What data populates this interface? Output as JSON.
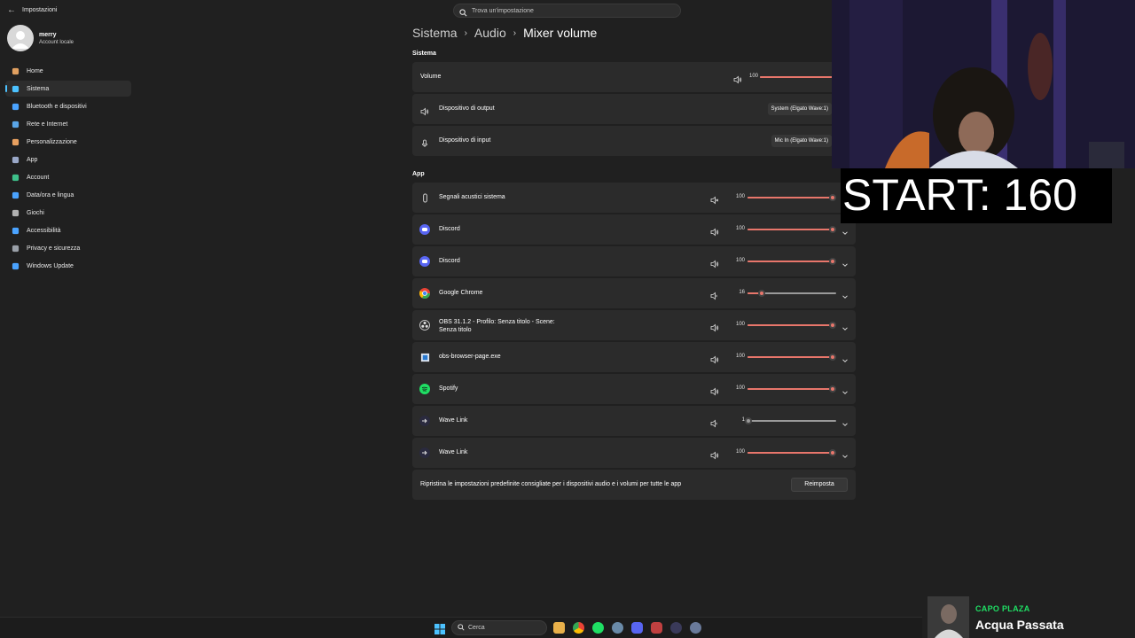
{
  "window": {
    "title": "Impostazioni"
  },
  "search": {
    "placeholder": "Trova un'impostazione"
  },
  "profile": {
    "name": "merry",
    "account_type": "Account locale"
  },
  "sidebar": {
    "items": [
      {
        "label": "Home",
        "icon": "home-icon",
        "color": "#e0a060"
      },
      {
        "label": "Sistema",
        "icon": "system-icon",
        "color": "#4cc2ff",
        "active": true
      },
      {
        "label": "Bluetooth e dispositivi",
        "icon": "bluetooth-icon",
        "color": "#4aa3ff"
      },
      {
        "label": "Rete e Internet",
        "icon": "wifi-icon",
        "color": "#5aa6e8"
      },
      {
        "label": "Personalizzazione",
        "icon": "brush-icon",
        "color": "#e8a060"
      },
      {
        "label": "App",
        "icon": "apps-icon",
        "color": "#9aa8c8"
      },
      {
        "label": "Account",
        "icon": "account-icon",
        "color": "#3ec08a"
      },
      {
        "label": "Data/ora e lingua",
        "icon": "globe-icon",
        "color": "#4aa3ff"
      },
      {
        "label": "Giochi",
        "icon": "gamepad-icon",
        "color": "#b0b0b0"
      },
      {
        "label": "Accessibilità",
        "icon": "accessibility-icon",
        "color": "#4aa3ff"
      },
      {
        "label": "Privacy e sicurezza",
        "icon": "shield-icon",
        "color": "#9aa0a8"
      },
      {
        "label": "Windows Update",
        "icon": "update-icon",
        "color": "#4aa3ff"
      }
    ]
  },
  "breadcrumb": {
    "items": [
      "Sistema",
      "Audio",
      "Mixer volume"
    ]
  },
  "system_section": {
    "title": "Sistema",
    "volume": {
      "label": "Volume",
      "value": "100",
      "level": 1.0
    },
    "output": {
      "label": "Dispositivo di output",
      "selected": "System (Elgato Wave:1)"
    },
    "input": {
      "label": "Dispositivo di input",
      "selected": "Mic In (Elgato Wave:1)"
    }
  },
  "app_section": {
    "title": "App",
    "apps": [
      {
        "name": "Segnali acustici sistema",
        "icon": "system-sounds-icon",
        "value": "100",
        "level": 1.0,
        "muted": true,
        "expandable": false
      },
      {
        "name": "Discord",
        "icon": "discord-icon",
        "value": "100",
        "level": 1.0,
        "muted": false,
        "expandable": true
      },
      {
        "name": "Discord",
        "icon": "discord-icon",
        "value": "100",
        "level": 1.0,
        "muted": false,
        "expandable": true
      },
      {
        "name": "Google Chrome",
        "icon": "chrome-icon",
        "value": "16",
        "level": 0.16,
        "muted": false,
        "low": true,
        "expandable": true
      },
      {
        "name": "OBS 31.1.2 - Profilo: Senza titolo - Scene: Senza titolo",
        "icon": "obs-icon",
        "value": "100",
        "level": 1.0,
        "muted": false,
        "expandable": true
      },
      {
        "name": "obs-browser-page.exe",
        "icon": "app-window-icon",
        "value": "100",
        "level": 1.0,
        "muted": false,
        "expandable": true
      },
      {
        "name": "Spotify",
        "icon": "spotify-icon",
        "value": "100",
        "level": 1.0,
        "muted": false,
        "expandable": true
      },
      {
        "name": "Wave Link",
        "icon": "wavelink-icon",
        "value": "1",
        "level": 0.01,
        "muted": false,
        "low": true,
        "expandable": true
      },
      {
        "name": "Wave Link",
        "icon": "wavelink-icon",
        "value": "100",
        "level": 1.0,
        "muted": false,
        "expandable": true
      }
    ]
  },
  "reset": {
    "text": "Ripristina le impostazioni predefinite consigliate per i dispositivi audio e i volumi per tutte le app",
    "button": "Reimposta"
  },
  "overlay": {
    "start_text": "START: 160"
  },
  "now_playing": {
    "artist": "CAPO PLAZA",
    "title": "Acqua Passata"
  },
  "taskbar": {
    "search_placeholder": "Cerca"
  },
  "colors": {
    "accent": "#4cc2ff",
    "slider": "#e8766b",
    "spotify": "#1fdf64",
    "discord": "#5865f2"
  }
}
